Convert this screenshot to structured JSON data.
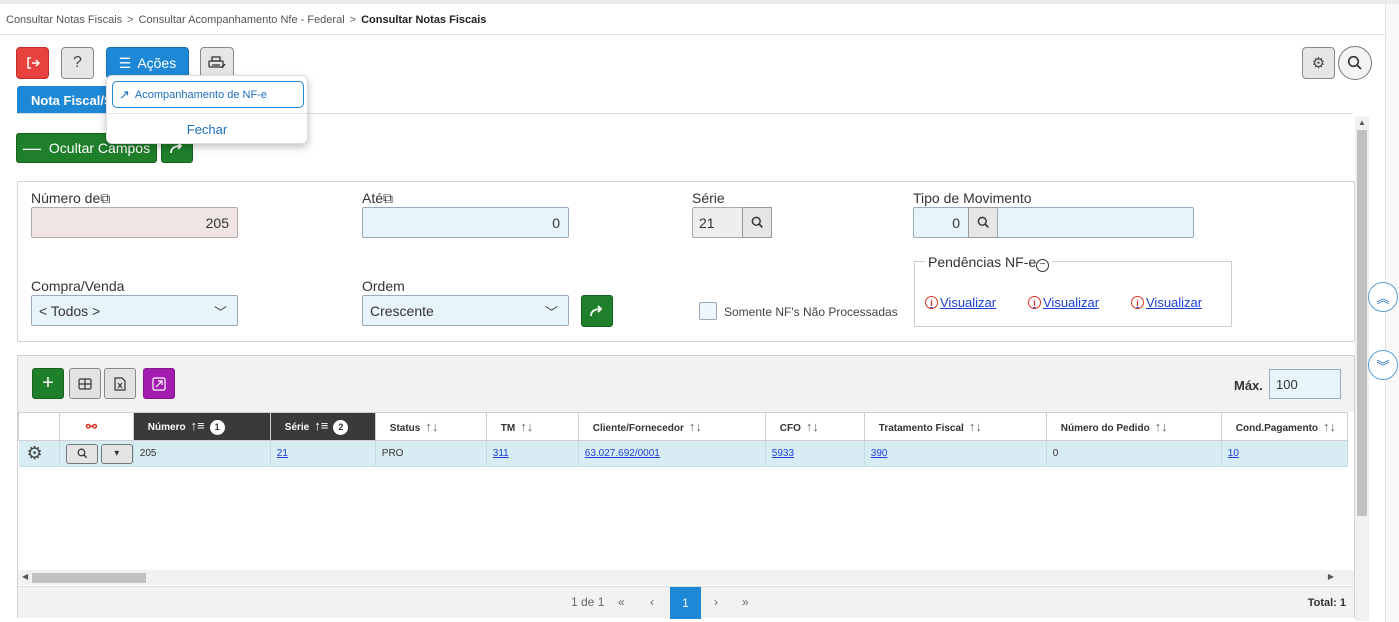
{
  "breadcrumb": [
    "Consultar Notas Fiscais",
    "Consultar Acompanhamento Nfe - Federal",
    "Consultar Notas Fiscais"
  ],
  "breadcrumb_sep": ">",
  "toolbar": {
    "help_label": "?",
    "acoes_label": "Ações"
  },
  "tab": {
    "label": "Nota Fiscal/S"
  },
  "dropdown": {
    "item_label": "Acompanhamento de NF-e",
    "close_label": "Fechar"
  },
  "buttons": {
    "ocultar_label": "Ocultar Campos"
  },
  "filters": {
    "numero_de": {
      "label": "Número de",
      "value": "205"
    },
    "ate": {
      "label": "Até",
      "value": "0"
    },
    "serie": {
      "label": "Série",
      "value": "21"
    },
    "tipo_movimento": {
      "label": "Tipo de Movimento",
      "value": "0",
      "desc": ""
    },
    "compra_venda": {
      "label": "Compra/Venda",
      "value": "< Todos >"
    },
    "ordem": {
      "label": "Ordem",
      "value": "Crescente"
    },
    "somente_label": "Somente NF's Não Processadas",
    "pendencias": {
      "legend": "Pendências NF-e",
      "links": [
        "Visualizar",
        "Visualizar",
        "Visualizar"
      ]
    }
  },
  "grid": {
    "max_label": "Máx.",
    "max_value": "100",
    "columns": [
      {
        "label": "Número",
        "sort_order": "1"
      },
      {
        "label": "Série",
        "sort_order": "2"
      },
      {
        "label": "Status"
      },
      {
        "label": "TM"
      },
      {
        "label": "Cliente/Fornecedor"
      },
      {
        "label": "CFO"
      },
      {
        "label": "Tratamento Fiscal"
      },
      {
        "label": "Número do Pedido"
      },
      {
        "label": "Cond.Pagamento"
      }
    ],
    "rows": [
      {
        "numero": "205",
        "serie": "21",
        "status": "PRO",
        "tm": "311",
        "cliente": "63.027.692/0001",
        "cfo": "5933",
        "tratamento": "390",
        "pedido": "0",
        "cond": "10"
      }
    ]
  },
  "pager": {
    "info": "1 de 1",
    "current_page": "1",
    "total": "Total: 1"
  },
  "colors": {
    "primary": "#1e88d6",
    "success": "#1f7f2a",
    "danger": "#e8423f",
    "purple": "#a21caf",
    "row_highlight": "#d8ecf3"
  }
}
